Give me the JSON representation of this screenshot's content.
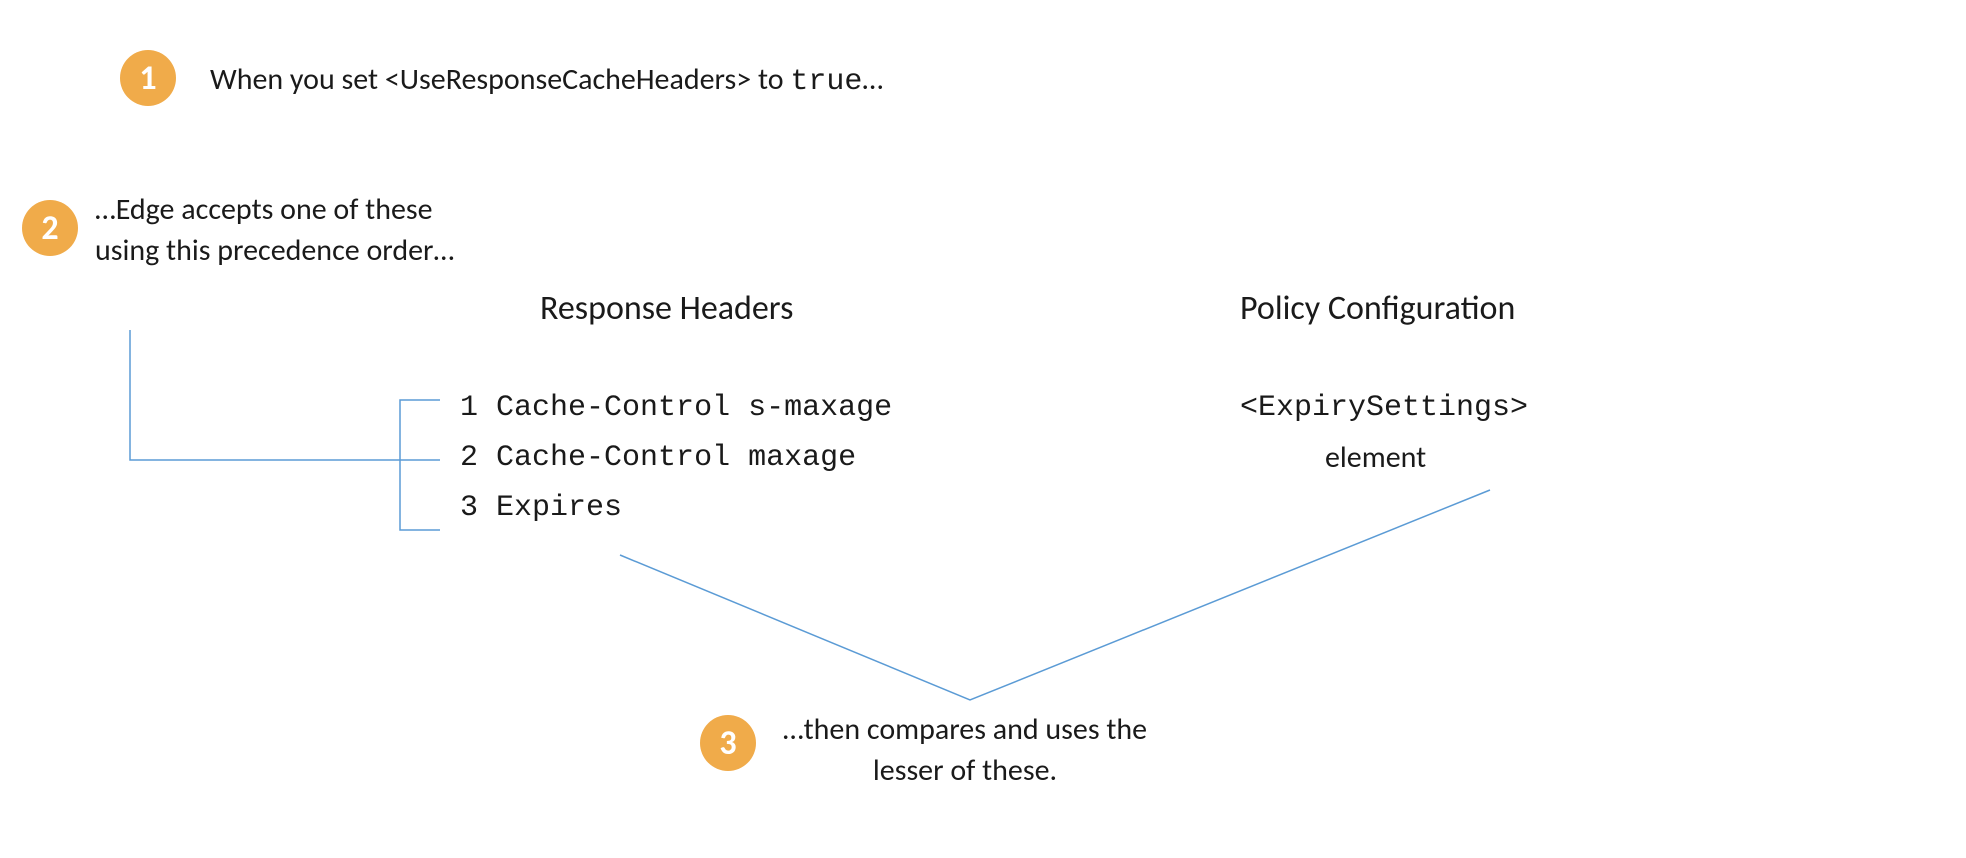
{
  "badges": {
    "one": "1",
    "two": "2",
    "three": "3"
  },
  "step1": {
    "prefix": "When you set ",
    "element": "<UseResponseCacheHeaders>",
    "mid": " to ",
    "value": "true",
    "suffix": "…"
  },
  "step2": {
    "text": "…Edge accepts one of these using this precedence order…"
  },
  "headings": {
    "response": "Response Headers",
    "policy": "Policy Configuration"
  },
  "headers_list": {
    "item1": {
      "num": "1",
      "label": "Cache-Control s-maxage"
    },
    "item2": {
      "num": "2",
      "label": "Cache-Control maxage"
    },
    "item3": {
      "num": "3",
      "label": "Expires"
    }
  },
  "policy": {
    "element": "<ExpirySettings>",
    "sub": "element"
  },
  "step3": {
    "text": "…then compares and uses the lesser of these."
  },
  "colors": {
    "badge": "#f0ab4a",
    "connector": "#5b9bd5"
  }
}
